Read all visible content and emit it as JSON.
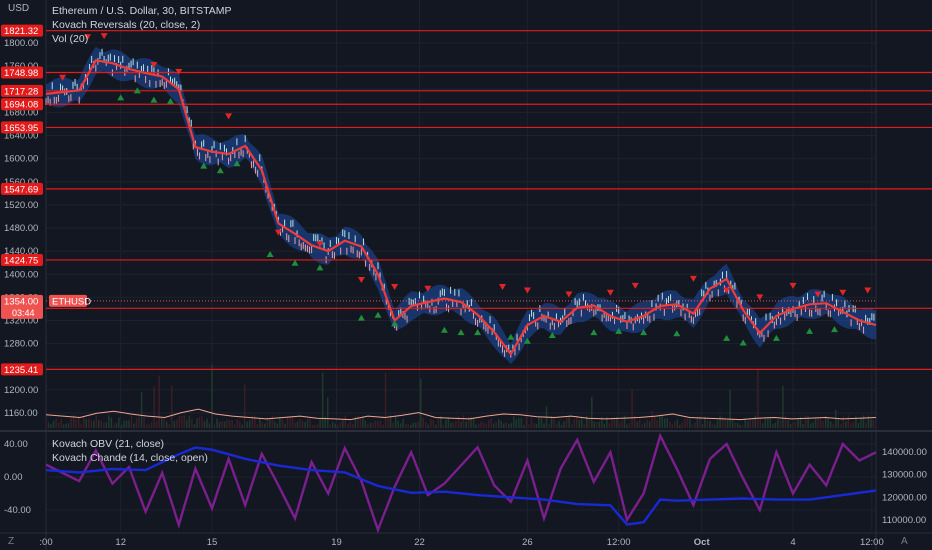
{
  "header": {
    "currency": "USD",
    "legend": [
      "Ethereum / U.S. Dollar, 30, BITSTAMP",
      "Kovach Reversals (20, close, 2)",
      "Vol (20)"
    ]
  },
  "lower_pane": {
    "legend": [
      "Kovach OBV (21, close)",
      "Kovach Chande (14, close, open)"
    ],
    "left_ticks": [
      "40.00",
      "0.00",
      "-40.00"
    ],
    "right_ticks": [
      "140000.00",
      "130000.00",
      "120000.00",
      "110000.00"
    ]
  },
  "controls": {
    "zoom_label": "Z",
    "auto_label": "A"
  },
  "colors": {
    "background": "#131722",
    "price_line": "#ef3b3b",
    "band": "#1e4fa8",
    "hline": "#e31b1b",
    "up_marker": "#1e8f3a",
    "down_marker": "#e02626",
    "obv": "#1a29d6",
    "chande": "#7c1f8e",
    "volume_ma": "#f0a58f"
  },
  "chart_data": [
    {
      "type": "line",
      "symbol": "ETHUSD",
      "title": "Ethereum / U.S. Dollar, 30, BITSTAMP",
      "ylim": [
        1140,
        1840
      ],
      "y_ticks": [
        1160,
        1200,
        1240,
        1280,
        1320,
        1360,
        1400,
        1440,
        1480,
        1520,
        1560,
        1600,
        1640,
        1680,
        1720,
        1760,
        1800
      ],
      "x_tick_labels": [
        ":00",
        "12",
        "15",
        "19",
        "22",
        "26",
        "12:00",
        "Oct",
        "4",
        "12:00"
      ],
      "last_price": {
        "value": "1354.00",
        "countdown": "03:44"
      },
      "horizontal_levels": [
        "1821.32",
        "1748.98",
        "1717.28",
        "1694.08",
        "1653.95",
        "1547.69",
        "1424.75",
        "1341.04",
        "1235.41"
      ],
      "series": [
        {
          "name": "Kovach Reversals (20, close, 2)",
          "x": [
            0,
            4,
            6,
            8,
            10,
            12,
            14,
            16,
            18,
            20,
            22,
            24,
            26,
            28,
            30,
            32,
            34,
            36,
            38,
            40,
            42,
            44,
            46,
            48,
            50,
            52,
            54,
            56,
            58,
            60,
            62,
            64,
            66,
            68,
            70,
            72,
            74,
            76,
            78,
            80,
            82,
            84,
            86,
            88,
            90,
            92,
            94,
            96,
            98,
            100
          ],
          "values": [
            1712,
            1718,
            1770,
            1765,
            1755,
            1748,
            1742,
            1720,
            1620,
            1612,
            1608,
            1622,
            1580,
            1488,
            1470,
            1450,
            1440,
            1458,
            1448,
            1400,
            1320,
            1345,
            1352,
            1358,
            1352,
            1330,
            1300,
            1262,
            1312,
            1328,
            1318,
            1342,
            1346,
            1328,
            1318,
            1328,
            1345,
            1348,
            1332,
            1375,
            1392,
            1338,
            1298,
            1328,
            1340,
            1348,
            1350,
            1335,
            1320,
            1312
          ]
        }
      ],
      "reversal_signals": {
        "down": [
          [
            2,
            1740
          ],
          [
            5,
            1810
          ],
          [
            7,
            1812
          ],
          [
            13,
            1762
          ],
          [
            16,
            1750
          ],
          [
            22,
            1673
          ],
          [
            28,
            1472
          ],
          [
            33,
            1452
          ],
          [
            38,
            1390
          ],
          [
            42,
            1378
          ],
          [
            46,
            1375
          ],
          [
            55,
            1378
          ],
          [
            58,
            1372
          ],
          [
            63,
            1365
          ],
          [
            68,
            1368
          ],
          [
            71,
            1380
          ],
          [
            78,
            1392
          ],
          [
            82,
            1372
          ],
          [
            86,
            1360
          ],
          [
            90,
            1380
          ],
          [
            93,
            1365
          ],
          [
            96,
            1368
          ],
          [
            99,
            1372
          ]
        ],
        "up": [
          [
            9,
            1706
          ],
          [
            11,
            1718
          ],
          [
            13,
            1702
          ],
          [
            15,
            1700
          ],
          [
            19,
            1588
          ],
          [
            21,
            1580
          ],
          [
            23,
            1592
          ],
          [
            27,
            1435
          ],
          [
            30,
            1420
          ],
          [
            33,
            1412
          ],
          [
            38,
            1325
          ],
          [
            40,
            1330
          ],
          [
            42,
            1315
          ],
          [
            48,
            1304
          ],
          [
            50,
            1300
          ],
          [
            52,
            1300
          ],
          [
            56,
            1292
          ],
          [
            58,
            1285
          ],
          [
            61,
            1295
          ],
          [
            66,
            1300
          ],
          [
            69,
            1302
          ],
          [
            72,
            1300
          ],
          [
            76,
            1298
          ],
          [
            82,
            1290
          ],
          [
            84,
            1282
          ],
          [
            88,
            1290
          ],
          [
            92,
            1302
          ],
          [
            95,
            1305
          ]
        ]
      },
      "volume_ma": [
        38,
        34,
        30,
        42,
        48,
        40,
        34,
        30,
        44,
        54,
        40,
        34,
        30,
        26,
        30,
        34,
        28,
        26,
        24,
        34,
        30,
        36,
        44,
        30,
        28,
        26,
        34,
        40,
        38,
        32,
        30,
        34,
        28,
        26,
        28,
        30,
        34,
        40,
        30,
        28,
        26,
        24,
        28,
        30,
        26,
        28,
        30,
        26,
        28,
        30
      ]
    },
    {
      "type": "line",
      "title": "",
      "series": [
        {
          "name": "Kovach OBV (21, close)",
          "axis": "right",
          "x": [
            0,
            4,
            8,
            12,
            16,
            18,
            20,
            24,
            28,
            32,
            36,
            40,
            44,
            48,
            52,
            56,
            60,
            64,
            68,
            70,
            72,
            74,
            76,
            80,
            84,
            88,
            92,
            96,
            100
          ],
          "values": [
            132000,
            131000,
            132500,
            132000,
            139000,
            142000,
            141000,
            137000,
            134000,
            132000,
            131000,
            125000,
            122000,
            122500,
            121000,
            120000,
            119000,
            117000,
            116500,
            108000,
            109000,
            119000,
            118500,
            119000,
            119500,
            119000,
            119000,
            121000,
            123000
          ]
        },
        {
          "name": "Kovach Chande (14, close, open)",
          "axis": "left",
          "x": [
            0,
            4,
            6,
            8,
            10,
            12,
            14,
            16,
            18,
            20,
            22,
            24,
            26,
            28,
            30,
            32,
            34,
            36,
            38,
            40,
            42,
            44,
            46,
            48,
            50,
            52,
            54,
            56,
            58,
            60,
            62,
            64,
            66,
            68,
            70,
            72,
            74,
            76,
            78,
            80,
            82,
            84,
            86,
            88,
            90,
            92,
            94,
            96,
            98,
            100
          ],
          "values": [
            15,
            -5,
            32,
            -8,
            12,
            -42,
            5,
            -58,
            10,
            -38,
            22,
            -34,
            28,
            -10,
            -50,
            18,
            -20,
            35,
            -5,
            -64,
            -12,
            30,
            -22,
            -8,
            14,
            36,
            -10,
            -30,
            20,
            -50,
            10,
            45,
            -6,
            30,
            -52,
            -20,
            50,
            10,
            -34,
            22,
            40,
            -2,
            -40,
            30,
            -20,
            15,
            -10,
            40,
            20,
            30
          ]
        }
      ]
    }
  ]
}
